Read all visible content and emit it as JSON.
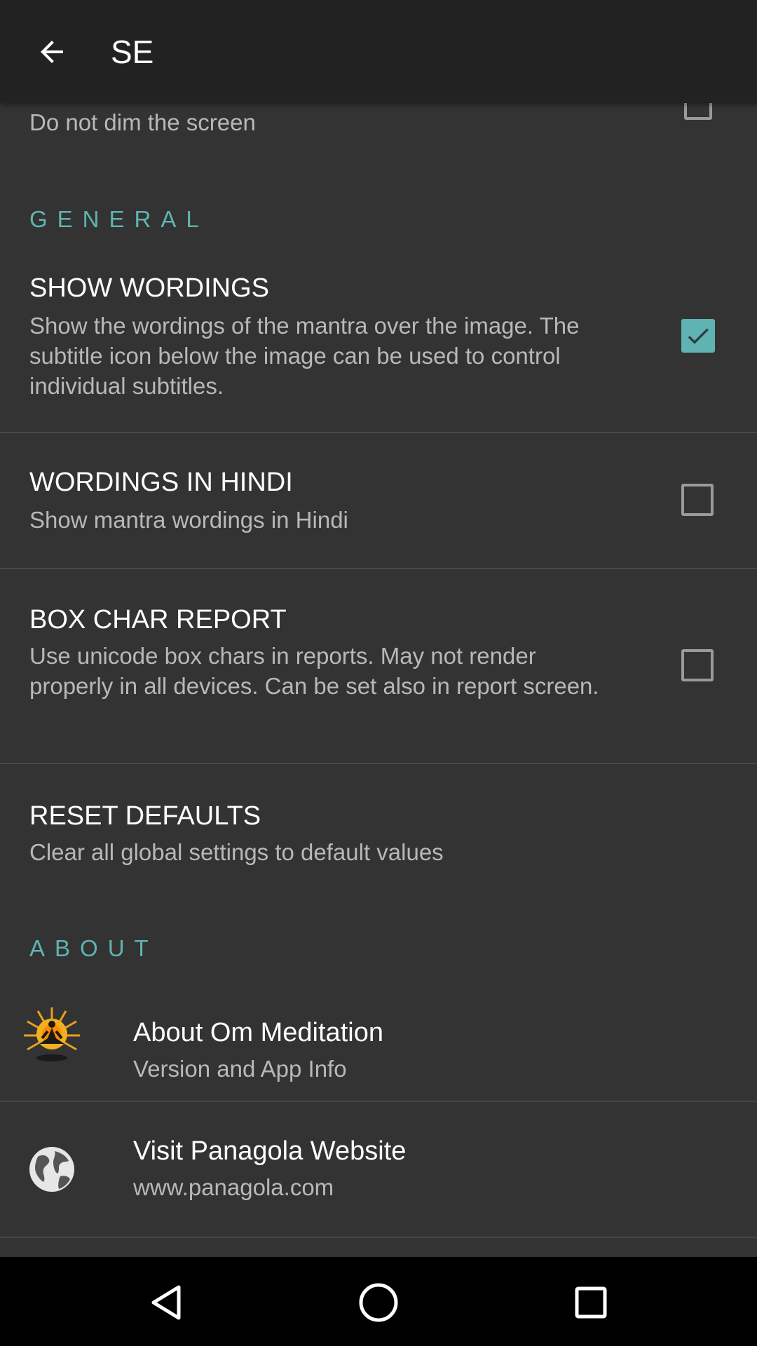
{
  "appbar": {
    "title": "SE"
  },
  "keep_screen_on": {
    "summary": "Do not dim the screen",
    "checked": false
  },
  "general": {
    "header": "GENERAL",
    "show_wordings": {
      "title": "SHOW WORDINGS",
      "summary": "Show the wordings of the mantra over the image. The subtitle icon below the image can be used to control individual subtitles.",
      "checked": true
    },
    "wordings_in_hindi": {
      "title": "WORDINGS IN HINDI",
      "summary": "Show mantra wordings in Hindi",
      "checked": false
    },
    "box_char_report": {
      "title": "BOX CHAR REPORT",
      "summary": "Use unicode box chars in reports. May not render properly in all devices. Can be set also in report screen.",
      "checked": false
    },
    "reset_defaults": {
      "title": "RESET DEFAULTS",
      "summary": "Clear all global settings to default values"
    }
  },
  "about": {
    "header": "ABOUT",
    "about_app": {
      "title": "About Om Meditation",
      "summary": "Version and App Info",
      "icon": "meditation-logo-icon"
    },
    "website": {
      "title": "Visit Panagola Website",
      "summary": "www.panagola.com",
      "icon": "globe-icon"
    }
  },
  "colors": {
    "accent": "#5fb3b3",
    "background": "#333333",
    "appbar": "#222222"
  }
}
